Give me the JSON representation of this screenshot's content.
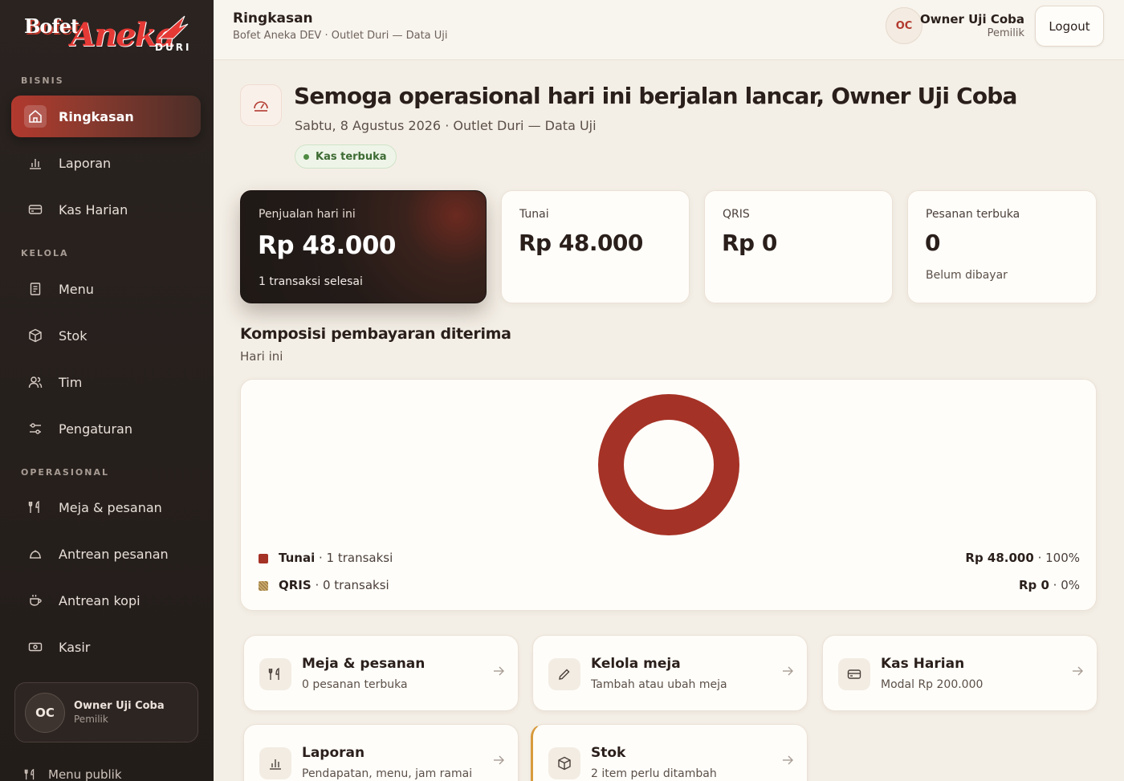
{
  "brand": {
    "line1": "Bofet",
    "line2": "Aneka",
    "line3": "DURI"
  },
  "sidebar": {
    "sections": [
      "BISNIS",
      "KELOLA",
      "OPERASIONAL"
    ],
    "items": [
      {
        "label": "Ringkasan",
        "icon": "home-icon",
        "active": true
      },
      {
        "label": "Laporan",
        "icon": "bar-chart-icon"
      },
      {
        "label": "Kas Harian",
        "icon": "wallet-icon"
      },
      {
        "label": "Menu",
        "icon": "menu-book-icon"
      },
      {
        "label": "Stok",
        "icon": "box-icon"
      },
      {
        "label": "Tim",
        "icon": "users-icon"
      },
      {
        "label": "Pengaturan",
        "icon": "sliders-icon"
      },
      {
        "label": "Meja & pesanan",
        "icon": "utensils-icon"
      },
      {
        "label": "Antrean pesanan",
        "icon": "cloche-icon"
      },
      {
        "label": "Antrean kopi",
        "icon": "coffee-icon"
      },
      {
        "label": "Kasir",
        "icon": "cash-icon"
      }
    ],
    "user": {
      "initials": "OC",
      "name": "Owner Uji Coba",
      "role": "Pemilik"
    },
    "menu_publik": "Menu publik"
  },
  "topbar": {
    "title": "Ringkasan",
    "subtitle": "Bofet Aneka DEV · Outlet Duri — Data Uji",
    "initials": "OC",
    "user_name": "Owner Uji Coba",
    "user_role": "Pemilik",
    "logout_label": "Logout"
  },
  "hero": {
    "title": "Semoga operasional hari ini berjalan lancar, Owner Uji Coba",
    "subtitle": "Sabtu, 8 Agustus 2026 · Outlet Duri — Data Uji",
    "badge": "Kas terbuka"
  },
  "stats": [
    {
      "label": "Penjualan hari ini",
      "value": "Rp 48.000",
      "note": "1 transaksi selesai"
    },
    {
      "label": "Tunai",
      "value": "Rp 48.000",
      "note": ""
    },
    {
      "label": "QRIS",
      "value": "Rp 0",
      "note": ""
    },
    {
      "label": "Pesanan terbuka",
      "value": "0",
      "note": "Belum dibayar"
    }
  ],
  "composition": {
    "title": "Komposisi pembayaran diterima",
    "subtitle": "Hari ini"
  },
  "chart_data": {
    "type": "pie",
    "donut": true,
    "categories": [
      "Tunai",
      "QRIS"
    ],
    "values": [
      48000,
      0
    ],
    "colors": [
      "#a53226",
      "#c9a86a"
    ],
    "legend": [
      {
        "name": "Tunai",
        "detail": " · 1 transaksi",
        "amount": "Rp 48.000",
        "pct": " · 100%"
      },
      {
        "name": "QRIS",
        "detail": " · 0 transaksi",
        "amount": "Rp 0",
        "pct": " · 0%"
      }
    ]
  },
  "actions": [
    {
      "title": "Meja & pesanan",
      "subtitle": "0 pesanan terbuka",
      "icon": "utensils-icon"
    },
    {
      "title": "Kelola meja",
      "subtitle": "Tambah atau ubah meja",
      "icon": "pencil-icon"
    },
    {
      "title": "Kas Harian",
      "subtitle": "Modal Rp 200.000",
      "icon": "wallet-icon"
    },
    {
      "title": "Laporan",
      "subtitle": "Pendapatan, menu, jam ramai",
      "icon": "bar-chart-icon"
    },
    {
      "title": "Stok",
      "subtitle": "2 item perlu ditambah",
      "icon": "box-icon"
    }
  ]
}
